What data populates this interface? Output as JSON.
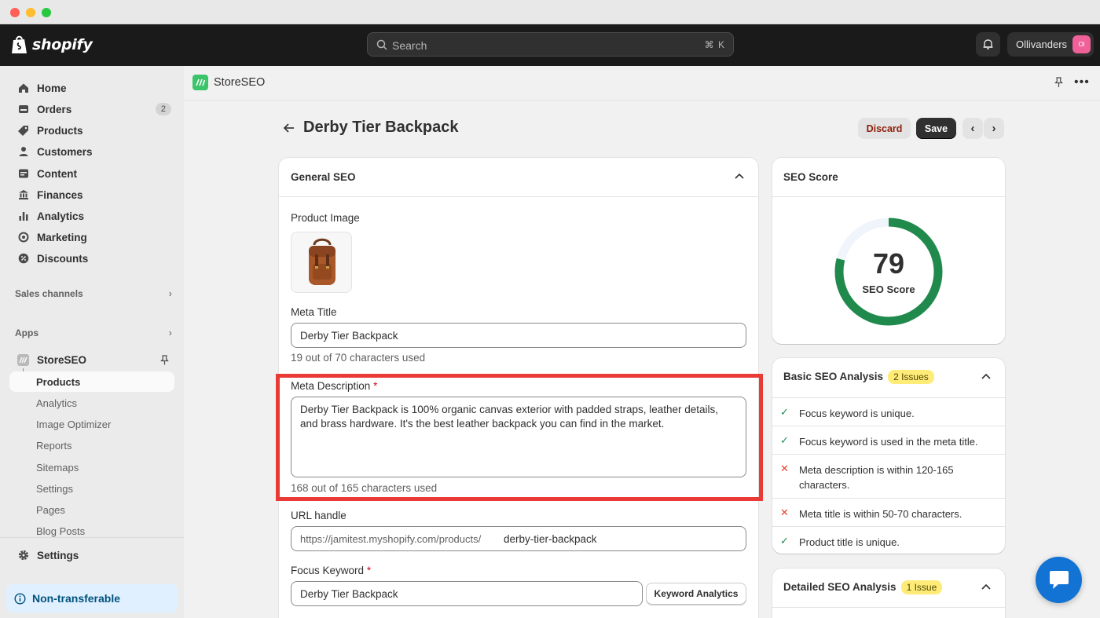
{
  "topbar": {
    "brand": "shopify",
    "search_placeholder": "Search",
    "search_shortcut": "⌘ K",
    "account_name": "Ollivanders",
    "account_initials": "Ol"
  },
  "sidebar": {
    "items": [
      {
        "label": "Home",
        "icon": "home-icon"
      },
      {
        "label": "Orders",
        "icon": "orders-icon",
        "badge": "2"
      },
      {
        "label": "Products",
        "icon": "tag-icon"
      },
      {
        "label": "Customers",
        "icon": "person-icon"
      },
      {
        "label": "Content",
        "icon": "content-icon"
      },
      {
        "label": "Finances",
        "icon": "bank-icon"
      },
      {
        "label": "Analytics",
        "icon": "bar-chart-icon"
      },
      {
        "label": "Marketing",
        "icon": "target-icon"
      },
      {
        "label": "Discounts",
        "icon": "discount-icon"
      }
    ],
    "sales_channels": "Sales channels",
    "apps": "Apps",
    "app_name": "StoreSEO",
    "app_subitems": [
      "Products",
      "Analytics",
      "Image Optimizer",
      "Reports",
      "Sitemaps",
      "Settings",
      "Pages",
      "Blog Posts"
    ],
    "settings": "Settings",
    "non_transferable": "Non-transferable"
  },
  "app": {
    "name": "StoreSEO"
  },
  "page": {
    "title": "Derby Tier Backpack",
    "discard": "Discard",
    "save": "Save"
  },
  "general_seo": {
    "heading": "General SEO",
    "product_image_label": "Product Image",
    "meta_title_label": "Meta Title",
    "meta_title_value": "Derby Tier Backpack",
    "meta_title_help": "19 out of 70 characters used",
    "meta_desc_label": "Meta Description",
    "meta_desc_value": "Derby Tier Backpack is 100% organic canvas exterior with padded straps, leather details, and brass hardware. It's the best leather backpack you can find in the market.",
    "meta_desc_help": "168 out of 165 characters used",
    "url_label": "URL handle",
    "url_prefix": "https://jamitest.myshopify.com/products/",
    "url_handle": "derby-tier-backpack",
    "focus_label": "Focus Keyword",
    "focus_value": "Derby Tier Backpack",
    "keyword_analytics": "Keyword Analytics",
    "required_mark": "*"
  },
  "seo_score": {
    "heading": "SEO Score",
    "value": "79",
    "label": "SEO Score",
    "percent": 79,
    "color": "#1f8a4c"
  },
  "basic_analysis": {
    "heading": "Basic SEO Analysis",
    "badge": "2 Issues",
    "items": [
      {
        "text": "Focus keyword is unique.",
        "ok": true
      },
      {
        "text": "Focus keyword is used in the meta title.",
        "ok": true
      },
      {
        "text": "Meta description is within 120-165 characters.",
        "ok": false
      },
      {
        "text": "Meta title is within 50-70 characters.",
        "ok": false
      },
      {
        "text": "Product title is unique.",
        "ok": true
      }
    ]
  },
  "detailed_analysis": {
    "heading": "Detailed SEO Analysis",
    "badge": "1 Issue"
  }
}
